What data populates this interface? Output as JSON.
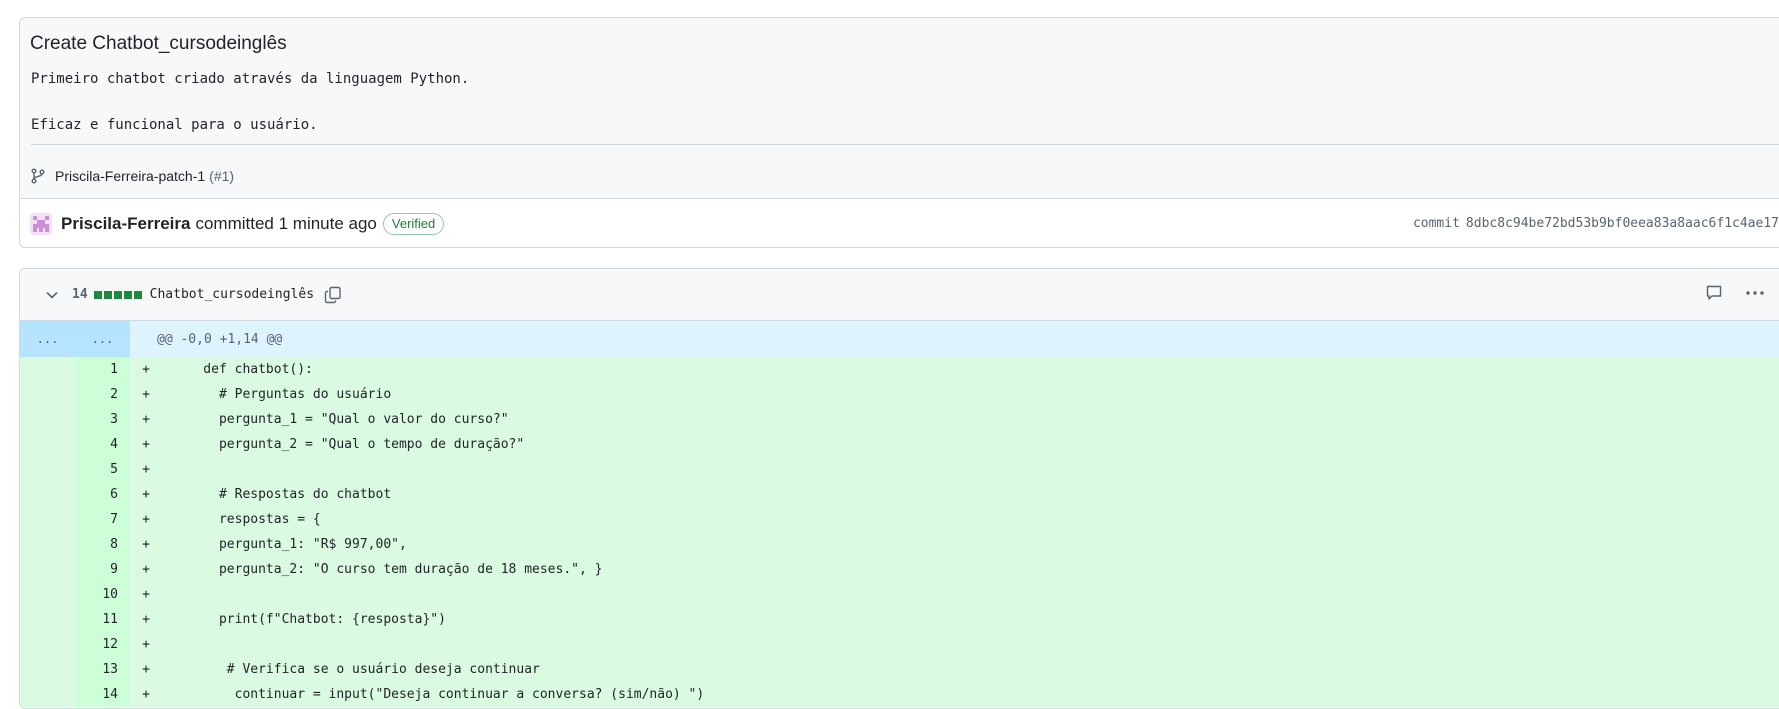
{
  "commit": {
    "title": "Create Chatbot_cursodeinglês",
    "description": "Primeiro chatbot criado através da linguagem Python.\n\nEficaz e funcional para o usuário.",
    "branch": "Priscila-Ferreira-patch-1",
    "pr_ref": "(#1)",
    "author": "Priscila-Ferreira",
    "action": "committed 1 minute ago",
    "verified_label": "Verified",
    "sha_label": "commit",
    "sha": "8dbc8c94be72bd53b9bf0eea83a8aac6f1c4ae17"
  },
  "file": {
    "changes": "14",
    "name": "Chatbot_cursodeinglês",
    "hunk_old": "...",
    "hunk_new": "...",
    "hunk_header": "@@ -0,0 +1,14 @@",
    "lines": [
      {
        "n": "1",
        "m": "+",
        "code": "    def chatbot():"
      },
      {
        "n": "2",
        "m": "+",
        "code": "      # Perguntas do usuário"
      },
      {
        "n": "3",
        "m": "+",
        "code": "      pergunta_1 = \"Qual o valor do curso?\""
      },
      {
        "n": "4",
        "m": "+",
        "code": "      pergunta_2 = \"Qual o tempo de duração?\""
      },
      {
        "n": "5",
        "m": "+",
        "code": ""
      },
      {
        "n": "6",
        "m": "+",
        "code": "      # Respostas do chatbot"
      },
      {
        "n": "7",
        "m": "+",
        "code": "      respostas = {"
      },
      {
        "n": "8",
        "m": "+",
        "code": "      pergunta_1: \"R$ 997,00\","
      },
      {
        "n": "9",
        "m": "+",
        "code": "      pergunta_2: \"O curso tem duração de 18 meses.\", }"
      },
      {
        "n": "10",
        "m": "+",
        "code": ""
      },
      {
        "n": "11",
        "m": "+",
        "code": "      print(f\"Chatbot: {resposta}\")"
      },
      {
        "n": "12",
        "m": "+",
        "code": ""
      },
      {
        "n": "13",
        "m": "+",
        "code": "       # Verifica se o usuário deseja continuar"
      },
      {
        "n": "14",
        "m": "+",
        "code": "        continuar = input(\"Deseja continuar a conversa? (sim/não) \")"
      }
    ]
  },
  "icons": {
    "branch": "git-branch-icon",
    "avatar": "identicon-avatar",
    "collapse": "chevron-down-icon",
    "copy": "copy-icon",
    "comment": "comment-icon",
    "more": "kebab-horizontal-icon"
  },
  "colors": {
    "addition_bg": "#dafbe1",
    "addition_num_bg": "#ccffd8",
    "hunk_bg": "#ddf4ff",
    "hunk_num_bg": "#b6e3ff",
    "verified": "#1a7f37",
    "diffstat": "#1f883d"
  }
}
